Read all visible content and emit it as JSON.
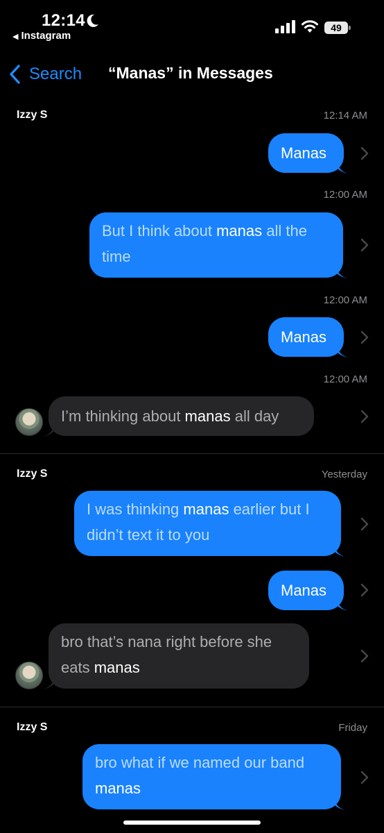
{
  "status": {
    "time": "12:14",
    "back_app": "Instagram",
    "battery": "49"
  },
  "nav": {
    "back_label": "Search",
    "title": "“Manas” in Messages"
  },
  "sections": [
    {
      "name": "Izzy S",
      "time": "12:14 AM",
      "messages": [
        {
          "direction": "outgoing",
          "parts": [
            {
              "text": "Manas",
              "highlight": true
            }
          ]
        },
        {
          "timestamp": "12:00 AM",
          "direction": "outgoing",
          "parts": [
            {
              "text": "But I think about ",
              "highlight": false
            },
            {
              "text": "manas",
              "highlight": true
            },
            {
              "text": " all the time",
              "highlight": false
            }
          ]
        },
        {
          "timestamp": "12:00 AM",
          "direction": "outgoing",
          "parts": [
            {
              "text": "Manas",
              "highlight": true
            }
          ]
        },
        {
          "timestamp": "12:00 AM",
          "direction": "incoming",
          "parts": [
            {
              "text": "I’m thinking about ",
              "highlight": false
            },
            {
              "text": "manas",
              "highlight": true
            },
            {
              "text": " all day",
              "highlight": false
            }
          ]
        }
      ]
    },
    {
      "name": "Izzy S",
      "time": "Yesterday",
      "messages": [
        {
          "direction": "outgoing",
          "parts": [
            {
              "text": "I was thinking ",
              "highlight": false
            },
            {
              "text": "manas",
              "highlight": true
            },
            {
              "text": " earlier but I didn’t text it to you",
              "highlight": false
            }
          ]
        },
        {
          "direction": "outgoing",
          "parts": [
            {
              "text": "Manas",
              "highlight": true
            }
          ]
        },
        {
          "direction": "incoming",
          "parts": [
            {
              "text": "bro that’s nana right before she eats ",
              "highlight": false
            },
            {
              "text": "manas",
              "highlight": true
            }
          ]
        }
      ]
    },
    {
      "name": "Izzy S",
      "time": "Friday",
      "messages": [
        {
          "direction": "outgoing",
          "parts": [
            {
              "text": "bro what if we named our band ",
              "highlight": false
            },
            {
              "text": "manas",
              "highlight": true
            }
          ]
        }
      ]
    }
  ],
  "colors": {
    "outgoing_bubble": "#1982fc",
    "incoming_bubble": "#262628",
    "accent": "#1b8cff",
    "secondary_text": "#8e8e93"
  }
}
